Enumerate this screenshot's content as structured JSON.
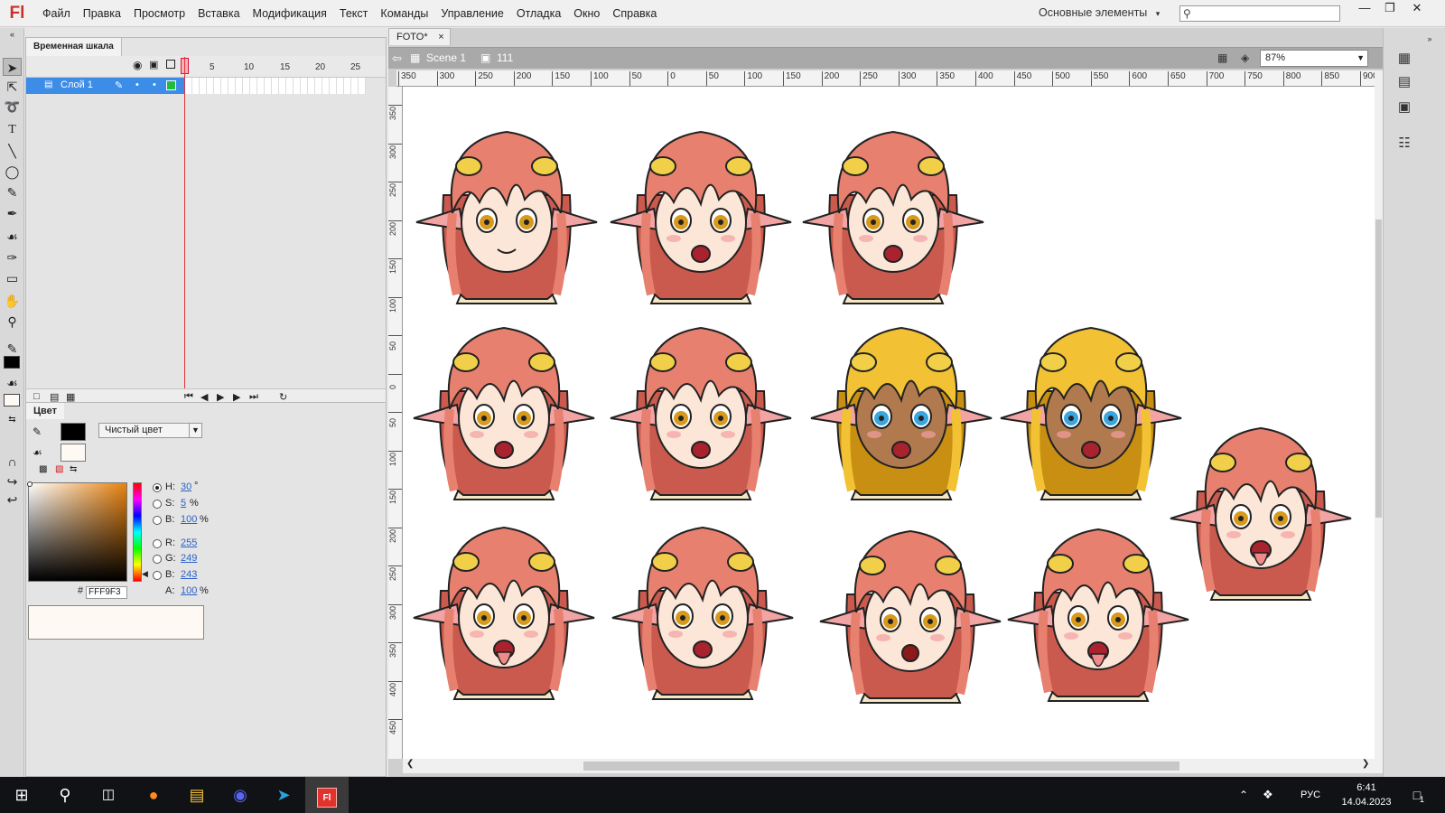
{
  "app": {
    "logo": "Fl"
  },
  "menu": [
    "Файл",
    "Правка",
    "Просмотр",
    "Вставка",
    "Модификация",
    "Текст",
    "Команды",
    "Управление",
    "Отладка",
    "Окно",
    "Справка"
  ],
  "workspace": {
    "label": "Основные элементы",
    "arrow": "▾"
  },
  "search": {
    "placeholder": "",
    "icon": "search-icon"
  },
  "window_controls": {
    "minimize": "—",
    "restore": "❐",
    "close": "✕"
  },
  "timeline": {
    "tab": "Временная шкала",
    "frame_numbers": [
      "1",
      "5",
      "10",
      "15",
      "20",
      "25"
    ],
    "layer_name": "Слой 1"
  },
  "color": {
    "tab": "Цвет",
    "fill_type": "Чистый цвет",
    "H": "30",
    "H_unit": "°",
    "S": "5",
    "S_unit": "%",
    "B": "100",
    "B_unit": "%",
    "R": "255",
    "G": "249",
    "Bv": "243",
    "A": "100",
    "A_unit": "%",
    "hex_label": "#",
    "hex": "FFF9F3",
    "labels": {
      "H": "H:",
      "S": "S:",
      "B": "B:",
      "R": "R:",
      "G": "G:",
      "Bc": "B:",
      "A": "A:"
    },
    "stroke_color": "#000000",
    "fill_color": "#FFF9F3"
  },
  "document": {
    "tab": "FOTO*",
    "tab_close": "×",
    "scene": "Scene 1",
    "symbol": "111",
    "zoom": "87%"
  },
  "ruler": {
    "h": [
      "350",
      "300",
      "250",
      "200",
      "150",
      "100",
      "50",
      "0",
      "50",
      "100",
      "150",
      "200",
      "250",
      "300",
      "350",
      "400",
      "450",
      "500",
      "550",
      "600",
      "650",
      "700",
      "750",
      "800",
      "850",
      "900"
    ],
    "v": [
      "350",
      "300",
      "250",
      "200",
      "150",
      "100",
      "50",
      "0",
      "50",
      "100",
      "150",
      "200",
      "250",
      "300",
      "350",
      "400",
      "450"
    ]
  },
  "taskbar": {
    "lang": "РУС",
    "time": "6:41",
    "date": "14.04.2023",
    "notif": "1"
  },
  "heads": [
    {
      "variant": "smile",
      "hair": "#e8806f"
    },
    {
      "variant": "shout",
      "hair": "#e8806f"
    },
    {
      "variant": "blush",
      "hair": "#e8806f"
    },
    {
      "variant": "open",
      "hair": "#e8806f"
    },
    {
      "variant": "makeup",
      "hair": "#e8806f"
    },
    {
      "variant": "gyaru",
      "hair": "#f2c234"
    },
    {
      "variant": "gyaru2",
      "hair": "#f2c234"
    },
    {
      "variant": "tears",
      "hair": "#e8806f"
    },
    {
      "variant": "drip",
      "hair": "#e8806f"
    },
    {
      "variant": "gag",
      "hair": "#e8806f"
    },
    {
      "variant": "ahegao",
      "hair": "#e8806f"
    },
    {
      "variant": "messy",
      "hair": "#e8806f"
    }
  ]
}
